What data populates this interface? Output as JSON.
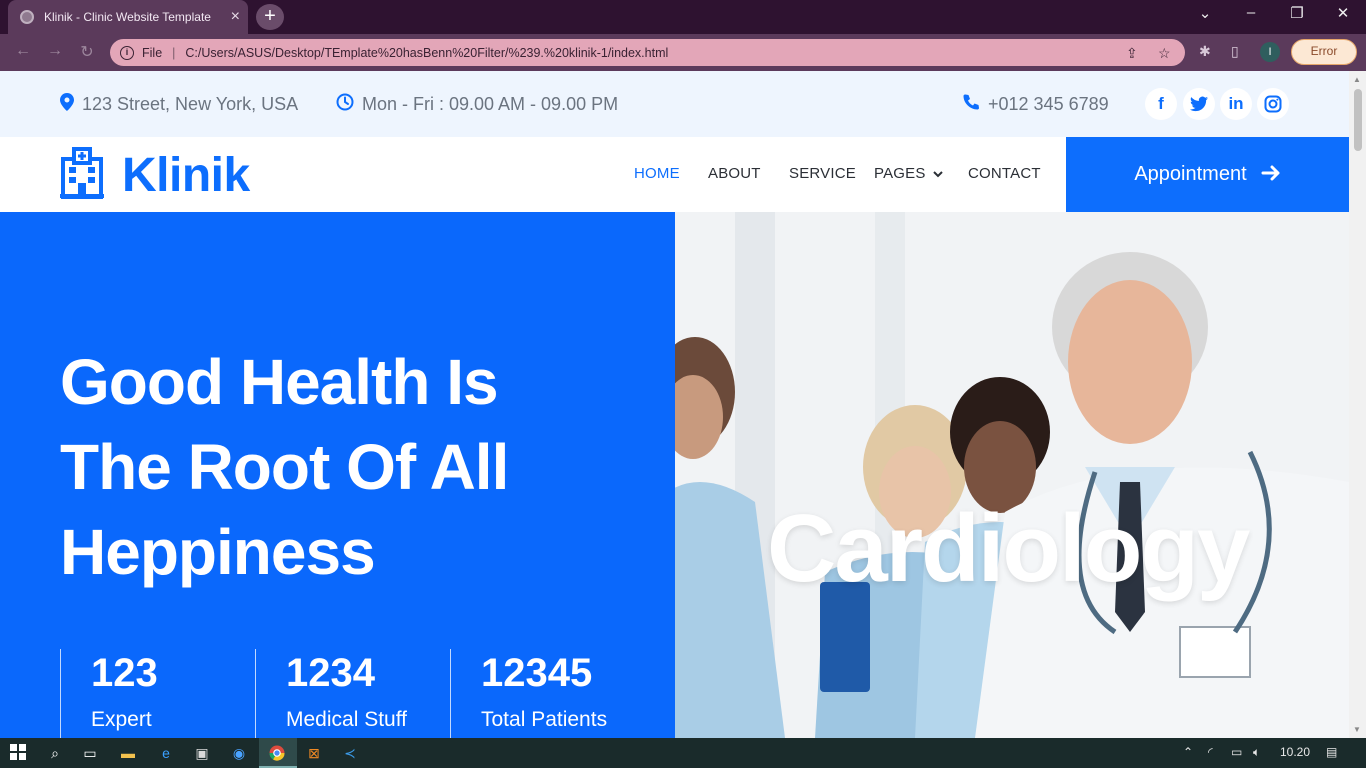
{
  "browser": {
    "tab_title": "Klinik - Clinic Website Template",
    "url_scheme": "File",
    "url": "C:/Users/ASUS/Desktop/TEmplate%20hasBenn%20Filter/%239.%20klinik-1/index.html",
    "profile_initial": "I",
    "status_pill": "Error"
  },
  "topbar": {
    "address": "123 Street, New York, USA",
    "hours": "Mon - Fri : 09.00 AM - 09.00 PM",
    "phone": "+012 345 6789",
    "socials": [
      "facebook",
      "twitter",
      "linkedin",
      "instagram"
    ]
  },
  "navbar": {
    "brand": "Klinik",
    "links": [
      "HOME",
      "ABOUT",
      "SERVICE",
      "PAGES",
      "CONTACT"
    ],
    "active": "HOME",
    "cta": "Appointment"
  },
  "hero": {
    "title_lines": [
      "Good Health Is",
      "The Root Of All",
      "Heppiness"
    ],
    "stats": [
      {
        "value": "123",
        "label": "Expert"
      },
      {
        "value": "1234",
        "label": "Medical Stuff"
      },
      {
        "value": "12345",
        "label": "Total Patients"
      }
    ],
    "slide_title": "Cardiology"
  },
  "taskbar": {
    "time": "10.20"
  },
  "colors": {
    "primary": "#0d6efd",
    "hero_blue": "#0a68fc",
    "topbar_bg": "#eef5fe"
  }
}
